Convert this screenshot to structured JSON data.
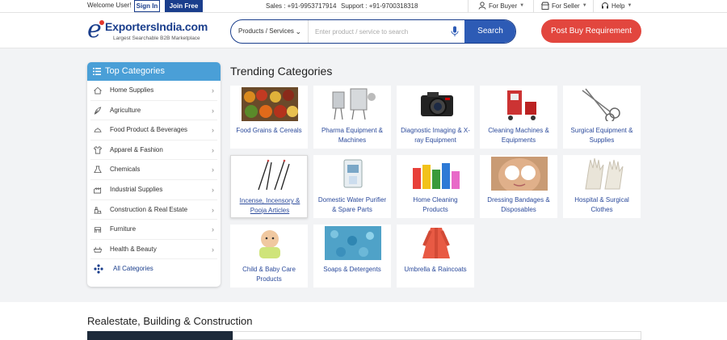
{
  "topbar": {
    "welcome": "Welcome User!",
    "signin": "Sign In",
    "join": "Join Free",
    "sales": "Sales : +91-9953717914",
    "support": "Support : +91-9700318318",
    "for_buyer": "For Buyer",
    "for_seller": "For Seller",
    "help": "Help"
  },
  "header": {
    "logo_name": "ExportersIndia.com",
    "logo_tagline": "Largest Searchable B2B Marketplace",
    "search_category": "Products / Services",
    "search_placeholder": "Enter product / service to search",
    "search_button": "Search",
    "post_button": "Post Buy Requirement"
  },
  "colors": {
    "brand_blue": "#1a3e8c",
    "sidebar_header": "#4a9fd7",
    "post_red": "#e2463e",
    "search_button": "#2d5bb5"
  },
  "sidebar": {
    "title": "Top Categories",
    "items": [
      {
        "label": "Home Supplies",
        "icon": "home-supplies-icon"
      },
      {
        "label": "Agriculture",
        "icon": "agriculture-icon"
      },
      {
        "label": "Food Product & Beverages",
        "icon": "food-icon"
      },
      {
        "label": "Apparel & Fashion",
        "icon": "apparel-icon"
      },
      {
        "label": "Chemicals",
        "icon": "chemicals-icon"
      },
      {
        "label": "Industrial Supplies",
        "icon": "industrial-icon"
      },
      {
        "label": "Construction & Real Estate",
        "icon": "construction-icon"
      },
      {
        "label": "Furniture",
        "icon": "furniture-icon"
      },
      {
        "label": "Health & Beauty",
        "icon": "health-beauty-icon"
      }
    ],
    "all_label": "All Categories"
  },
  "trending": {
    "title": "Trending Categories",
    "tiles": [
      {
        "label": "Food Grains & Cereals"
      },
      {
        "label": "Pharma Equipment & Machines"
      },
      {
        "label": "Diagnostic Imaging & X-ray Equipment"
      },
      {
        "label": "Cleaning Machines & Equipments"
      },
      {
        "label": "Surgical Equipment & Supplies"
      },
      {
        "label": "Incense, Incensory & Pooja Articles"
      },
      {
        "label": "Domestic Water Purifier & Spare Parts"
      },
      {
        "label": "Home Cleaning Products"
      },
      {
        "label": "Dressing Bandages & Disposables"
      },
      {
        "label": "Hospital & Surgical Clothes"
      },
      {
        "label": "Child & Baby Care Products"
      },
      {
        "label": "Soaps & Detergents"
      },
      {
        "label": "Umbrella & Raincoats"
      }
    ]
  },
  "section2": {
    "title": "Realestate, Building & Construction"
  }
}
